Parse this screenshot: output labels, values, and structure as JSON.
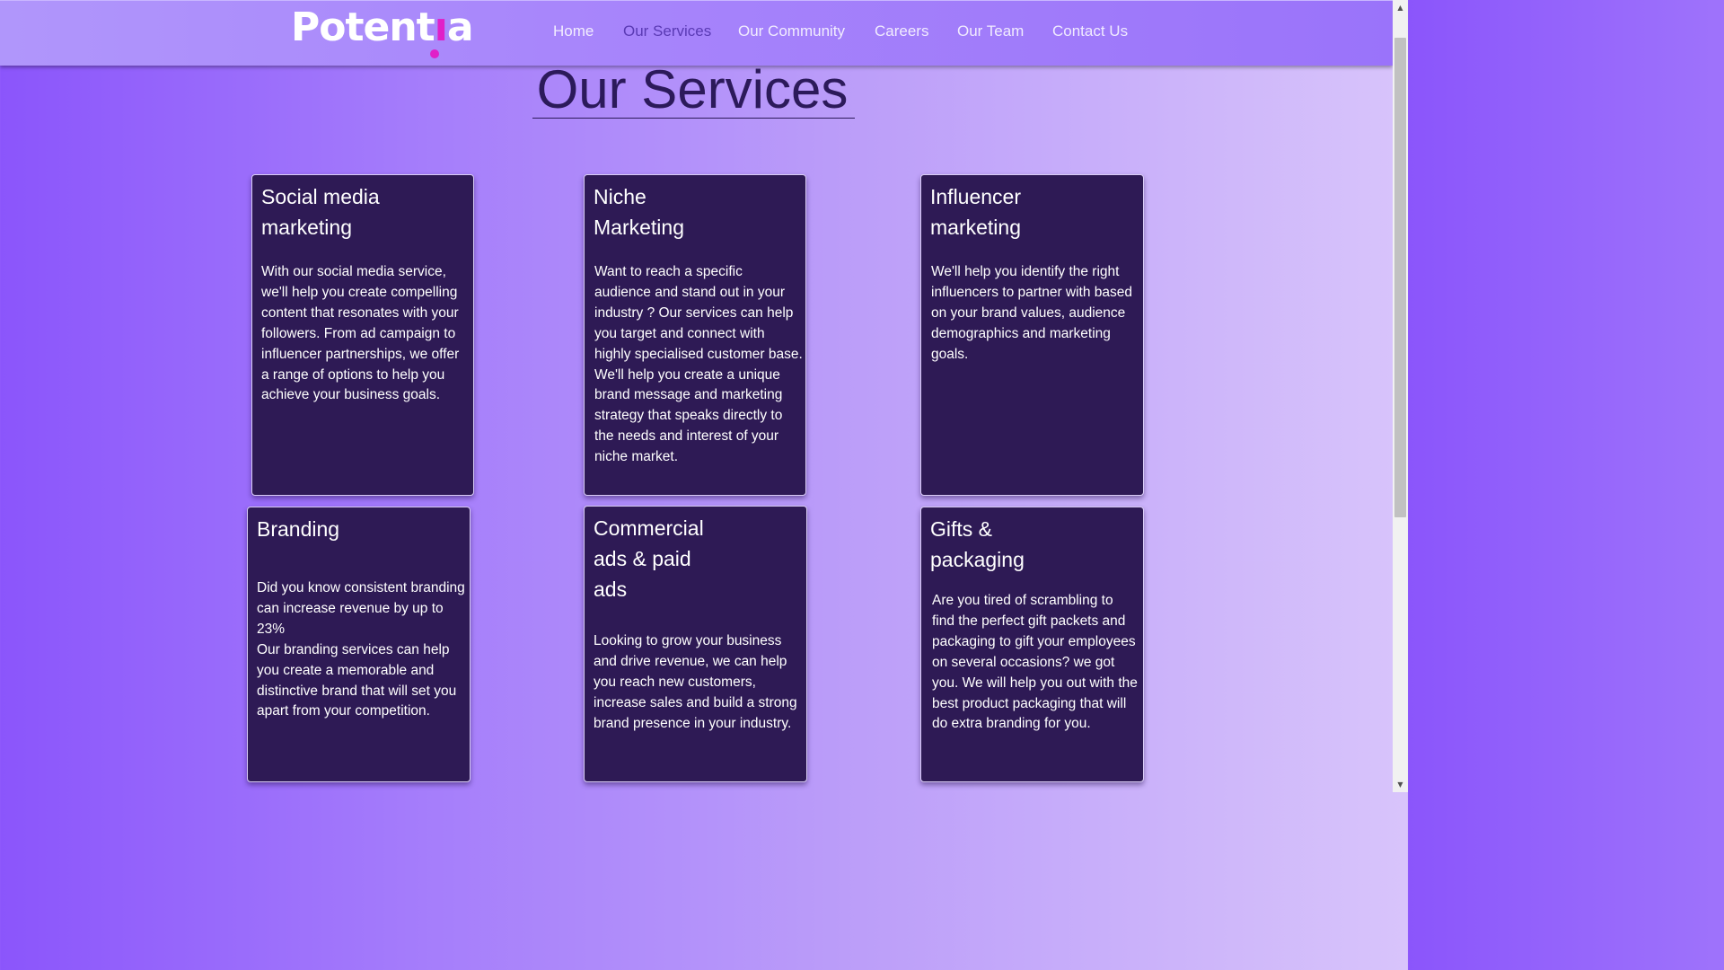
{
  "header": {
    "logo_text_left": "Potent",
    "logo_text_i": "ı",
    "logo_text_right": "a",
    "nav": [
      {
        "label": "Home",
        "active": false
      },
      {
        "label": "Our Services",
        "active": true
      },
      {
        "label": "Our Community",
        "active": false
      },
      {
        "label": "Careers",
        "active": false
      },
      {
        "label": "Our Team",
        "active": false
      },
      {
        "label": "Contact Us",
        "active": false
      }
    ]
  },
  "main": {
    "title": "Our Services",
    "cards": [
      {
        "title": "Social media\nmarketing",
        "text": "With our social media service, we'll help you create compelling content that resonates with your followers. From ad campaign to influencer partnerships, we offer a range of options to help you achieve your business goals."
      },
      {
        "title": "Niche\nMarketing",
        "text": "Want to reach a specific audience and stand out in your industry ? Our services can help you target and connect with highly specialised customer base. We'll help you create a unique brand message and marketing strategy that speaks directly to the needs and interest of your niche market."
      },
      {
        "title": "Influencer\nmarketing",
        "text": "We'll help you identify the right influencers to partner with based on your brand values, audience demographics and marketing goals."
      },
      {
        "title": "Branding",
        "text": "Did you know consistent branding can increase revenue by up to 23%\nOur branding services can help you create a memorable and distinctive brand that will set you apart from your competition."
      },
      {
        "title": "Commercial\nads & paid\nads",
        "text": "Looking to grow your business and drive revenue, we can help you reach new customers, increase sales and build a strong brand presence in your industry."
      },
      {
        "title": "Gifts &\npackaging",
        "text": "Are you tired of scrambling to find the perfect gift packets and packaging to gift your employees on several occasions? we got you. We will help you out with the best product packaging that will do extra branding for you."
      }
    ]
  },
  "colors": {
    "card_bg": "#2e1a55",
    "title": "#2c1a5a",
    "active_nav": "#5a3ab4",
    "logo_accent": "#e020c8"
  },
  "scrollbar": {
    "up_icon": "triangle-up",
    "down_icon": "triangle-down"
  }
}
